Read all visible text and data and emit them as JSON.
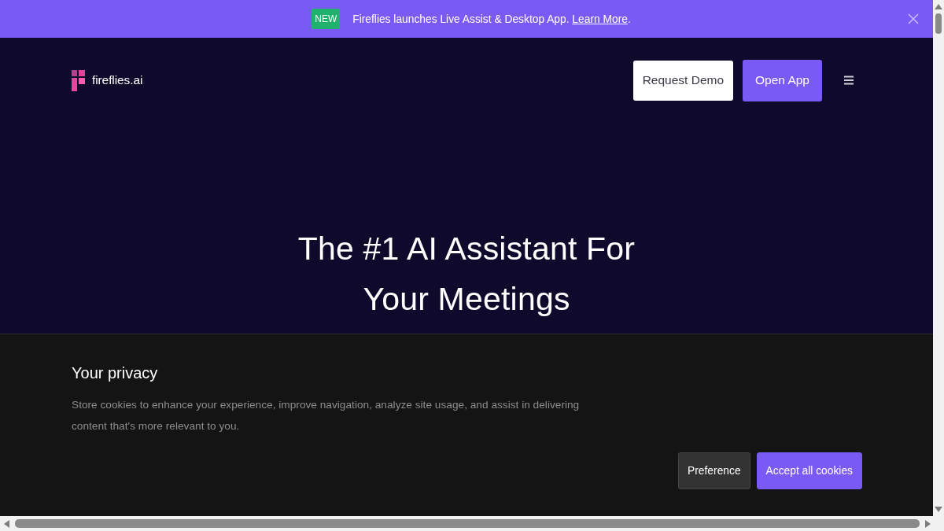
{
  "announcement": {
    "badge": "NEW",
    "text": "Fireflies launches Live Assist & Desktop App. ",
    "link": "Learn More",
    "after_link": "."
  },
  "header": {
    "logo": "fireflies.ai",
    "buttons": [
      {
        "label": "Request Demo",
        "kind": "secondary"
      },
      {
        "label": "Open App",
        "kind": "primary"
      }
    ]
  },
  "hero": {
    "title_lines": [
      "The #1 AI Assistant For",
      "Your Meetings"
    ]
  },
  "cookie_banner": {
    "title": "Your privacy",
    "text": "Store cookies to enhance your experience, improve navigation, analyze site usage, and assist in delivering content that's more relevant to you.",
    "buttons": [
      {
        "label": "Preference",
        "kind": "secondary"
      },
      {
        "label": "Accept all cookies",
        "kind": "primary"
      }
    ]
  }
}
